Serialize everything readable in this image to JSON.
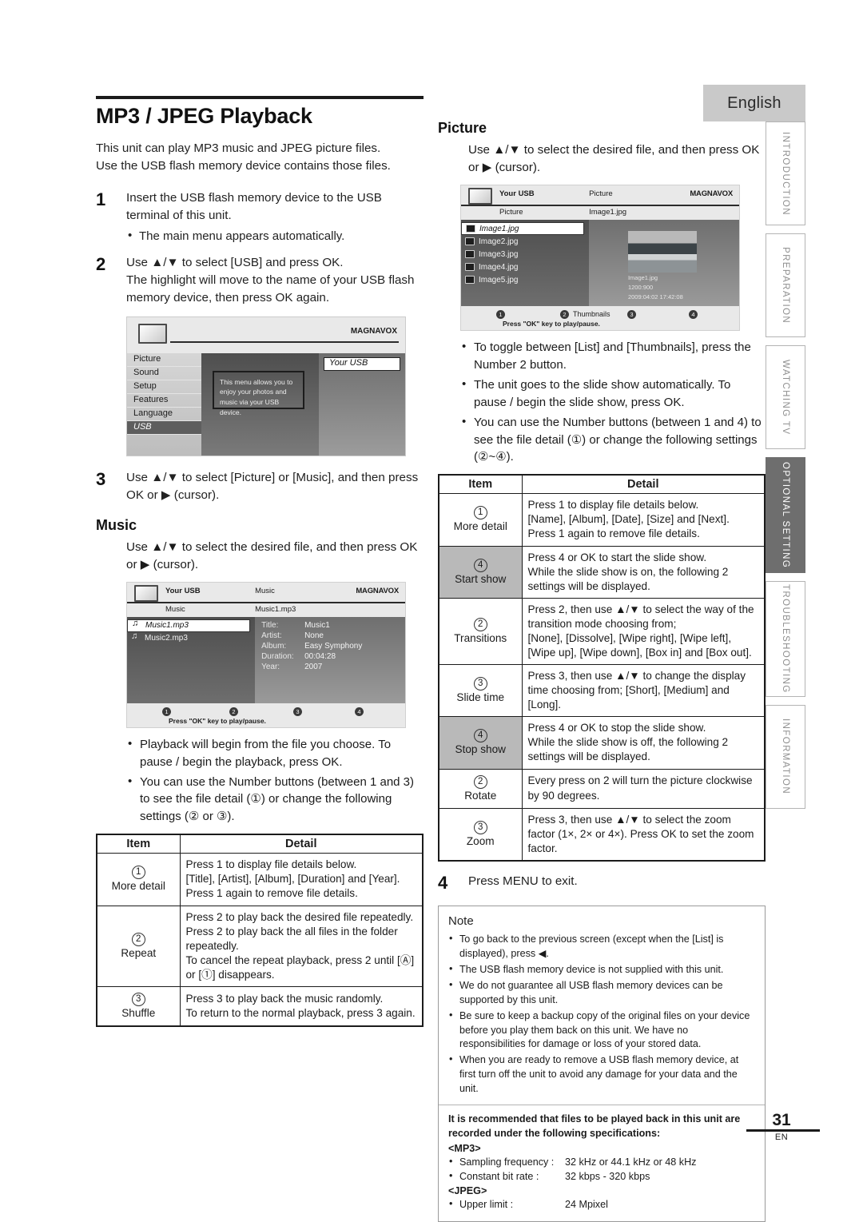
{
  "language_tab": "English",
  "side_tabs": [
    {
      "label": "INTRODUCTION",
      "active": false
    },
    {
      "label": "PREPARATION",
      "active": false
    },
    {
      "label": "WATCHING TV",
      "active": false
    },
    {
      "label": "OPTIONAL SETTING",
      "active": true
    },
    {
      "label": "TROUBLESHOOTING",
      "active": false
    },
    {
      "label": "INFORMATION",
      "active": false
    }
  ],
  "page_title": "MP3 / JPEG Playback",
  "intro_line1": "This unit can play MP3 music and JPEG picture files.",
  "intro_line2": "Use the USB flash memory device contains those files.",
  "steps": {
    "s1_num": "1",
    "s1_text": "Insert the USB flash memory device to the USB terminal of this unit.",
    "s1_bullet": "The main menu appears automatically.",
    "s2_num": "2",
    "s2_line1": "Use ▲/▼ to select [USB] and press OK.",
    "s2_line2": "The highlight will move to the name of your USB flash memory device, then press OK again.",
    "s3_num": "3",
    "s3_text": "Use ▲/▼ to select [Picture] or [Music], and then press OK or ▶ (cursor).",
    "s4_num": "4",
    "s4_text": "Press MENU to exit."
  },
  "main_menu_shot": {
    "brand": "MAGNAVOX",
    "items": [
      "Picture",
      "Sound",
      "Setup",
      "Features",
      "Language",
      "USB"
    ],
    "selected_item": "USB",
    "tip": "This menu allows you to enjoy your photos and music via your USB device.",
    "usb_label": "Your USB"
  },
  "music": {
    "heading": "Music",
    "intro": "Use ▲/▼ to select the desired file, and then press OK or ▶ (cursor).",
    "shot": {
      "head_left": "Your USB",
      "head_center": "Music",
      "brand": "MAGNAVOX",
      "sub_left": "Music",
      "sub_center": "Music1.mp3",
      "files": [
        "Music1.mp3",
        "Music2.mp3"
      ],
      "selected_file": "Music1.mp3",
      "detail": [
        {
          "key": "Title:",
          "value": "Music1"
        },
        {
          "key": "Artist:",
          "value": "None"
        },
        {
          "key": "Album:",
          "value": "Easy Symphony"
        },
        {
          "key": "Duration:",
          "value": "00:04:28"
        },
        {
          "key": "Year:",
          "value": "2007"
        }
      ],
      "keys": [
        "1",
        "2",
        "3",
        "4"
      ],
      "foot_note": "Press \"OK\" key to play/pause."
    },
    "bullets": [
      "Playback will begin from the file you choose. To pause / begin the playback, press OK.",
      "You can use the Number buttons (between 1 and 3) to see the file detail (①) or change the following settings (② or ③)."
    ],
    "table": {
      "col_item": "Item",
      "col_detail": "Detail",
      "rows": [
        {
          "num": "1",
          "name": "More detail",
          "shaded": false,
          "detail_lines": [
            "Press 1 to display file details below.",
            "[Title], [Artist], [Album], [Duration] and [Year].",
            "Press 1 again to remove file details."
          ]
        },
        {
          "num": "2",
          "name": "Repeat",
          "shaded": false,
          "detail_lines": [
            "Press 2 to play back the desired file repeatedly.",
            "Press 2 to play back the all files in the folder repeatedly.",
            "To cancel the repeat playback, press 2 until [Ⓐ] or [①] disappears."
          ]
        },
        {
          "num": "3",
          "name": "Shuffle",
          "shaded": false,
          "detail_lines": [
            "Press 3 to play back the music randomly.",
            "To return to the normal playback, press 3 again."
          ]
        }
      ]
    }
  },
  "picture": {
    "heading": "Picture",
    "intro": "Use ▲/▼ to select the desired file, and then press OK or ▶ (cursor).",
    "shot": {
      "head_left": "Your USB",
      "head_center": "Picture",
      "brand": "MAGNAVOX",
      "sub_left": "Picture",
      "sub_center": "Image1.jpg",
      "files": [
        "Image1.jpg",
        "Image2.jpg",
        "Image3.jpg",
        "Image4.jpg",
        "Image5.jpg"
      ],
      "selected_file": "Image1.jpg",
      "preview_name": "Image1.jpg",
      "preview_size": "1200:900",
      "preview_date": "2009:04:02 17:42:08",
      "keys": [
        "1",
        "2",
        "3",
        "4"
      ],
      "key2_caption": "Thumbnails",
      "foot_note": "Press \"OK\" key to play/pause."
    },
    "bullets": [
      "To toggle between [List] and [Thumbnails], press the Number 2 button.",
      "The unit goes to the slide show automatically. To pause / begin the slide show, press OK.",
      "You can use the Number buttons (between 1 and 4) to see the file detail (①) or change the following settings (②~④)."
    ],
    "table": {
      "col_item": "Item",
      "col_detail": "Detail",
      "rows": [
        {
          "num": "1",
          "name": "More detail",
          "shaded": false,
          "detail_lines": [
            "Press 1 to display file details below.",
            "[Name], [Album], [Date], [Size] and [Next].",
            "Press 1 again to remove file details."
          ]
        },
        {
          "num": "4",
          "name": "Start show",
          "shaded": true,
          "detail_lines": [
            "Press 4 or OK to start the slide show.",
            "While the slide show is on, the following 2 settings will be displayed."
          ]
        },
        {
          "num": "2",
          "name": "Transitions",
          "shaded": false,
          "detail_lines": [
            "Press 2, then use ▲/▼ to select the way of the transition mode choosing from;",
            "[None], [Dissolve], [Wipe right], [Wipe left], [Wipe up], [Wipe down], [Box in] and [Box out]."
          ]
        },
        {
          "num": "3",
          "name": "Slide time",
          "shaded": false,
          "detail_lines": [
            "Press 3, then use ▲/▼ to change the display time choosing from; [Short], [Medium] and [Long]."
          ]
        },
        {
          "num": "4",
          "name": "Stop show",
          "shaded": true,
          "detail_lines": [
            "Press 4 or OK to stop the slide show.",
            "While the slide show is off, the following 2 settings will be displayed."
          ]
        },
        {
          "num": "2",
          "name": "Rotate",
          "shaded": false,
          "detail_lines": [
            "Every press on 2 will turn the picture clockwise by 90 degrees."
          ]
        },
        {
          "num": "3",
          "name": "Zoom",
          "shaded": false,
          "detail_lines": [
            "Press 3, then use ▲/▼ to select the zoom factor (1×, 2× or 4×). Press OK to set the zoom factor."
          ]
        }
      ]
    }
  },
  "note": {
    "title": "Note",
    "bullets": [
      "To go back to the previous screen (except when the [List] is displayed), press ◀.",
      "The USB flash memory device is not supplied with this unit.",
      "We do not guarantee all USB flash memory devices can be supported by this unit.",
      "Be sure to keep a backup copy of the original files on your device before you play them back on this unit. We have no responsibilities for damage or loss of your stored data.",
      "When you are ready to remove a USB flash memory device, at first turn off the unit to avoid any damage for your data and the unit."
    ],
    "spec_intro": "It is recommended that files to be played back in this unit are recorded under the following specifications:",
    "mp3_tag": "<MP3>",
    "mp3_specs": [
      {
        "key": "Sampling frequency :",
        "value": "32 kHz or 44.1 kHz or 48 kHz"
      },
      {
        "key": "Constant bit rate :",
        "value": "32 kbps - 320 kbps"
      }
    ],
    "jpeg_tag": "<JPEG>",
    "jpeg_specs": [
      {
        "key": "Upper limit :",
        "value": "24 Mpixel"
      }
    ]
  },
  "footer": {
    "page_number": "31",
    "lang_code": "EN"
  }
}
